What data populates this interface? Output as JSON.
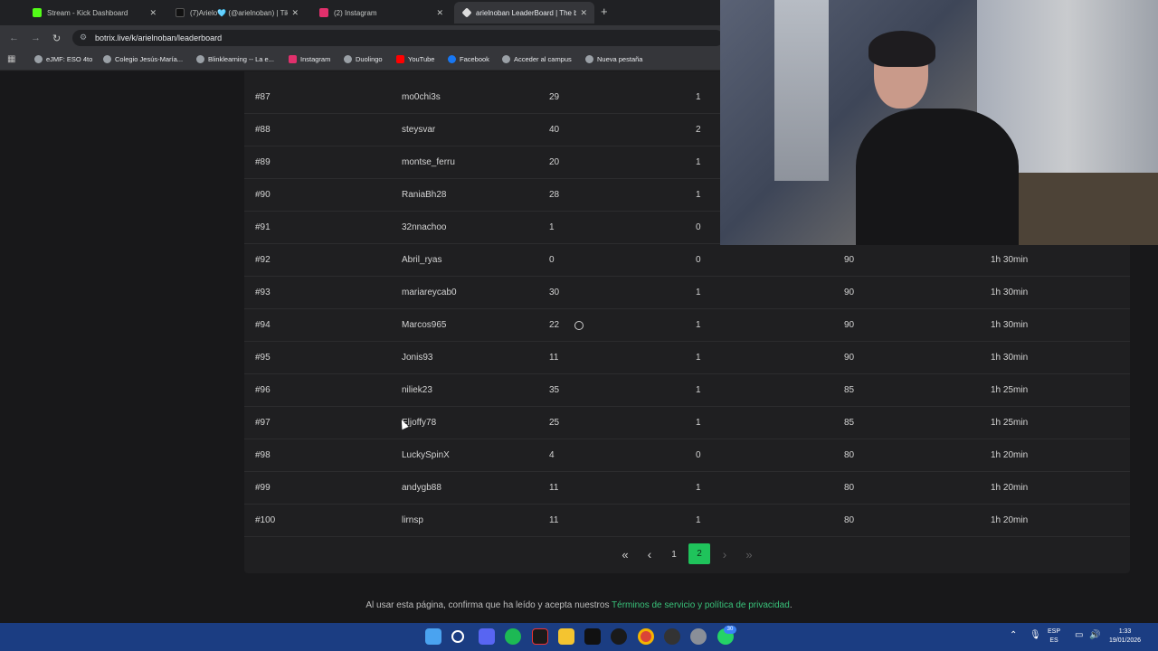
{
  "browser": {
    "tabs": [
      {
        "title": "Stream - Kick Dashboard",
        "favicon_color": "#53fc18"
      },
      {
        "title": "(7)Arielo🩵 (@arielnoban) | Tik",
        "favicon_color": "#111111"
      },
      {
        "title": "(2) Instagram",
        "favicon_color": "#e1306c"
      },
      {
        "title": "arielnoban LeaderBoard | The b",
        "favicon_color": "#dddddd"
      }
    ],
    "url": "botrix.live/k/arielnoban/leaderboard",
    "bookmarks": [
      "eJMF: ESO 4to",
      "Colegio Jesús-María...",
      "Blinklearning -- La e...",
      "Instagram",
      "Duolingo",
      "YouTube",
      "Facebook",
      "Acceder al campus",
      "Nueva pestaña"
    ]
  },
  "leaderboard": {
    "rows": [
      {
        "rank": "#87",
        "user": "mo0chi3s",
        "col3": "29",
        "col4": "1",
        "col5": "",
        "col6": ""
      },
      {
        "rank": "#88",
        "user": "steysvar",
        "col3": "40",
        "col4": "2",
        "col5": "",
        "col6": ""
      },
      {
        "rank": "#89",
        "user": "montse_ferru",
        "col3": "20",
        "col4": "1",
        "col5": "",
        "col6": ""
      },
      {
        "rank": "#90",
        "user": "RaniaBh28",
        "col3": "28",
        "col4": "1",
        "col5": "",
        "col6": ""
      },
      {
        "rank": "#91",
        "user": "32nnachoo",
        "col3": "1",
        "col4": "0",
        "col5": "",
        "col6": ""
      },
      {
        "rank": "#92",
        "user": "Abril_ryas",
        "col3": "0",
        "col4": "0",
        "col5": "90",
        "col6": "1h 30min"
      },
      {
        "rank": "#93",
        "user": "mariareycab0",
        "col3": "30",
        "col4": "1",
        "col5": "90",
        "col6": "1h 30min"
      },
      {
        "rank": "#94",
        "user": "Marcos965",
        "col3": "22",
        "col4": "1",
        "col5": "90",
        "col6": "1h 30min"
      },
      {
        "rank": "#95",
        "user": "Jonis93",
        "col3": "11",
        "col4": "1",
        "col5": "90",
        "col6": "1h 30min"
      },
      {
        "rank": "#96",
        "user": "niliek23",
        "col3": "35",
        "col4": "1",
        "col5": "85",
        "col6": "1h 25min"
      },
      {
        "rank": "#97",
        "user": "Eljoffy78",
        "col3": "25",
        "col4": "1",
        "col5": "85",
        "col6": "1h 25min"
      },
      {
        "rank": "#98",
        "user": "LuckySpinX",
        "col3": "4",
        "col4": "0",
        "col5": "80",
        "col6": "1h 20min"
      },
      {
        "rank": "#99",
        "user": "andygb88",
        "col3": "11",
        "col4": "1",
        "col5": "80",
        "col6": "1h 20min"
      },
      {
        "rank": "#100",
        "user": "lirnsp",
        "col3": "11",
        "col4": "1",
        "col5": "80",
        "col6": "1h 20min"
      }
    ],
    "pagination": {
      "first": "«",
      "prev": "‹",
      "pages": [
        "1",
        "2"
      ],
      "current": "2",
      "next": "›",
      "last": "»"
    }
  },
  "footer": {
    "text": "Al usar esta página, confirma que ha leído y acepta nuestros ",
    "link": "Términos de servicio y política de privacidad",
    "end": "."
  },
  "taskbar": {
    "lang_top": "ESP",
    "lang_bottom": "ES",
    "time": "1:33",
    "date": "19/01/2026",
    "badge": "30"
  },
  "colors": {
    "accent": "#1fc35b",
    "link": "#39c27a",
    "taskbar": "#1b3d82"
  }
}
